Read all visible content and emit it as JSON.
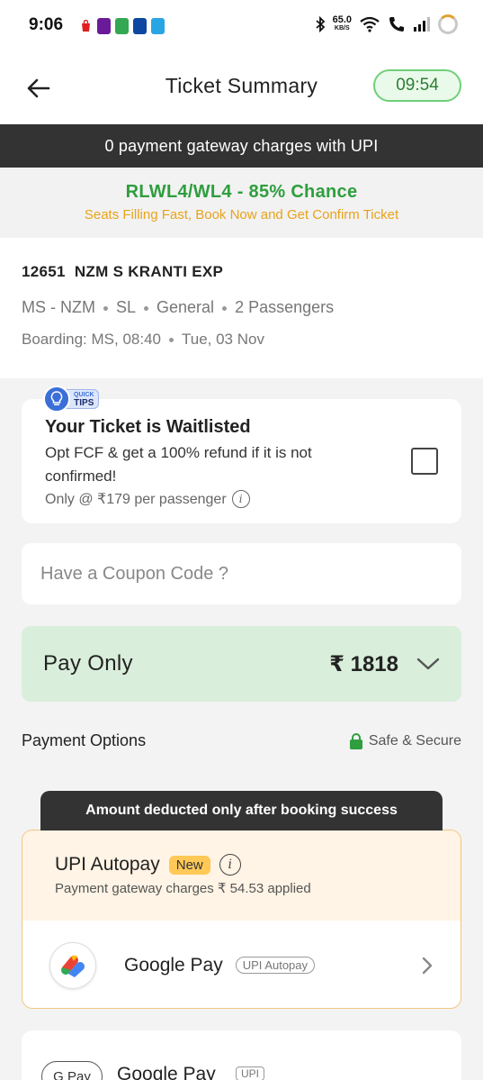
{
  "status_bar": {
    "time": "9:06",
    "net_speed_value": "65.0",
    "net_speed_unit": "KB/S"
  },
  "header": {
    "title": "Ticket Summary",
    "timer": "09:54"
  },
  "upi_banner": "0 payment gateway charges with UPI",
  "chance": {
    "status": "RLWL4/WL4 - 85% Chance",
    "message": "Seats Filling Fast, Book Now and Get Confirm Ticket"
  },
  "train": {
    "number": "12651",
    "name": "NZM S KRANTI EXP",
    "route": "MS - NZM",
    "class": "SL",
    "quota": "General",
    "passengers": "2 Passengers",
    "boarding": "Boarding: MS, 08:40",
    "date": "Tue, 03 Nov"
  },
  "quick_tips": {
    "tag_top": "QUICK",
    "tag_bottom": "TIPS"
  },
  "waitlist": {
    "title": "Your Ticket is Waitlisted",
    "description": "Opt FCF & get a 100% refund if it is not confirmed!",
    "price": "Only @ ₹179 per passenger",
    "checked": false
  },
  "coupon": {
    "placeholder": "Have a Coupon Code ?"
  },
  "pay": {
    "label": "Pay Only",
    "amount": "₹ 1818"
  },
  "payment_options": {
    "title": "Payment Options",
    "secure_label": "Safe & Secure"
  },
  "deduct_notice": "Amount deducted only after booking success",
  "upi_autopay": {
    "title": "UPI Autopay",
    "badge": "New",
    "charges": "Payment gateway charges ₹ 54.53 applied",
    "method_name": "Google Pay",
    "method_tag": "UPI Autopay"
  },
  "next_method": {
    "logo_text": "G Pay",
    "name": "Google Pay",
    "tag": "UPI"
  },
  "colors": {
    "accent_green": "#2e9e3e",
    "warning_orange": "#e8a31a",
    "pay_bg": "#d9eedb",
    "dark_banner": "#333333"
  }
}
